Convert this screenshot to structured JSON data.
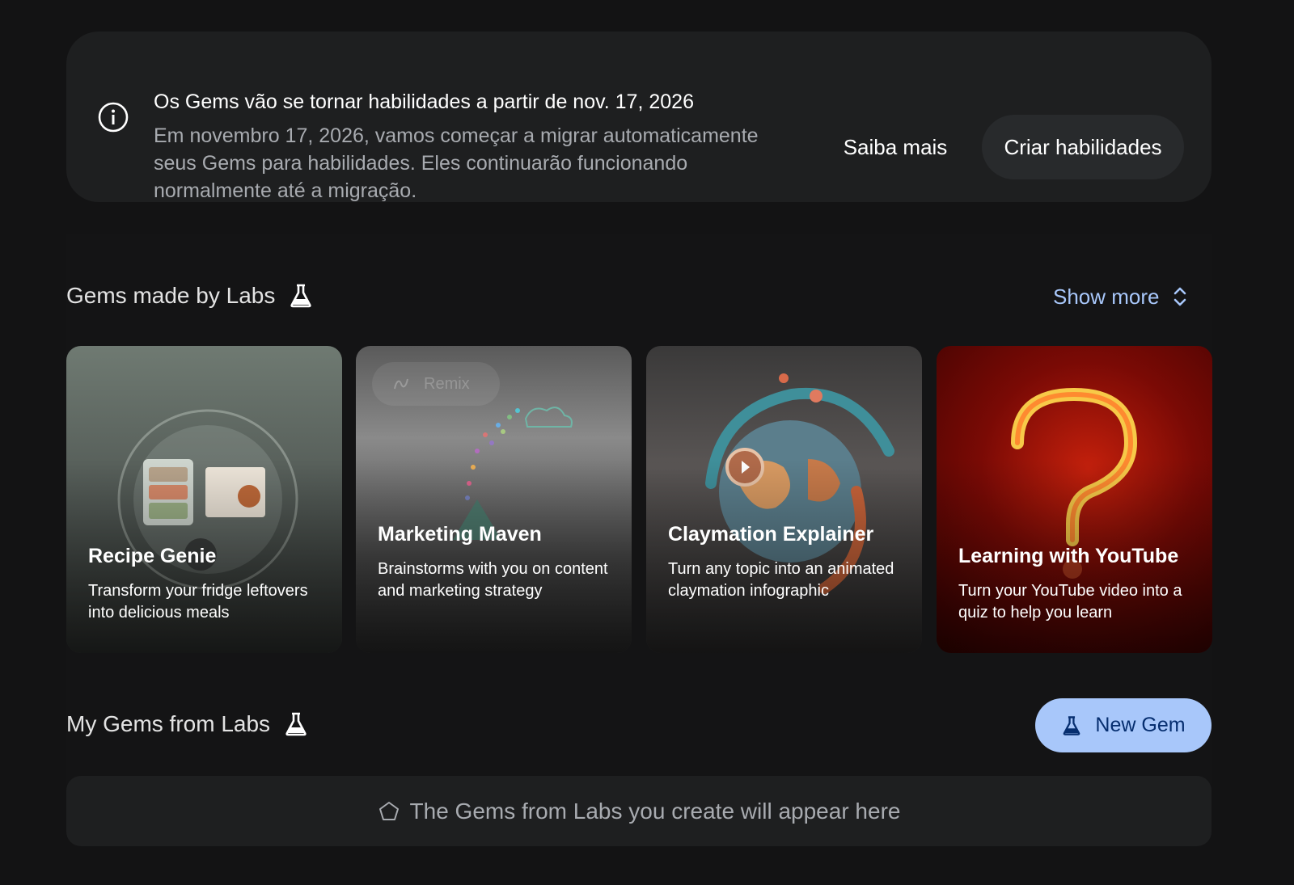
{
  "banner": {
    "title": "Os Gems vão se tornar habilidades a partir de nov. 17, 2026",
    "body": "Em novembro 17, 2026, vamos começar a migrar automaticamente seus Gems para habilidades. Eles continuarão funcionando normalmente até a migração.",
    "learn_more_label": "Saiba mais",
    "create_label": "Criar habilidades",
    "icon": "info-icon"
  },
  "labs_section": {
    "title": "Gems made by Labs",
    "icon": "flask-icon",
    "show_more_label": "Show more",
    "show_more_icon": "expand-icon"
  },
  "cards": [
    {
      "title": "Recipe Genie",
      "description": "Transform your fridge leftovers into delicious meals"
    },
    {
      "title": "Marketing Maven",
      "description": "Brainstorms with you on content and marketing strategy",
      "remix_label": "Remix"
    },
    {
      "title": "Claymation Explainer",
      "description": "Turn any topic into an animated claymation infographic"
    },
    {
      "title": "Learning with YouTube",
      "description": "Turn your YouTube video into a quiz to help you learn"
    }
  ],
  "my_gems": {
    "title": "My Gems from Labs",
    "icon": "flask-icon",
    "new_gem_label": "New Gem",
    "empty_text": "The Gems from Labs you create will appear here",
    "empty_icon": "pentagon-icon"
  },
  "colors": {
    "background": "#131314",
    "surface": "#1e1f20",
    "accent": "#a8c7fa",
    "accent_text": "#062e6f"
  }
}
